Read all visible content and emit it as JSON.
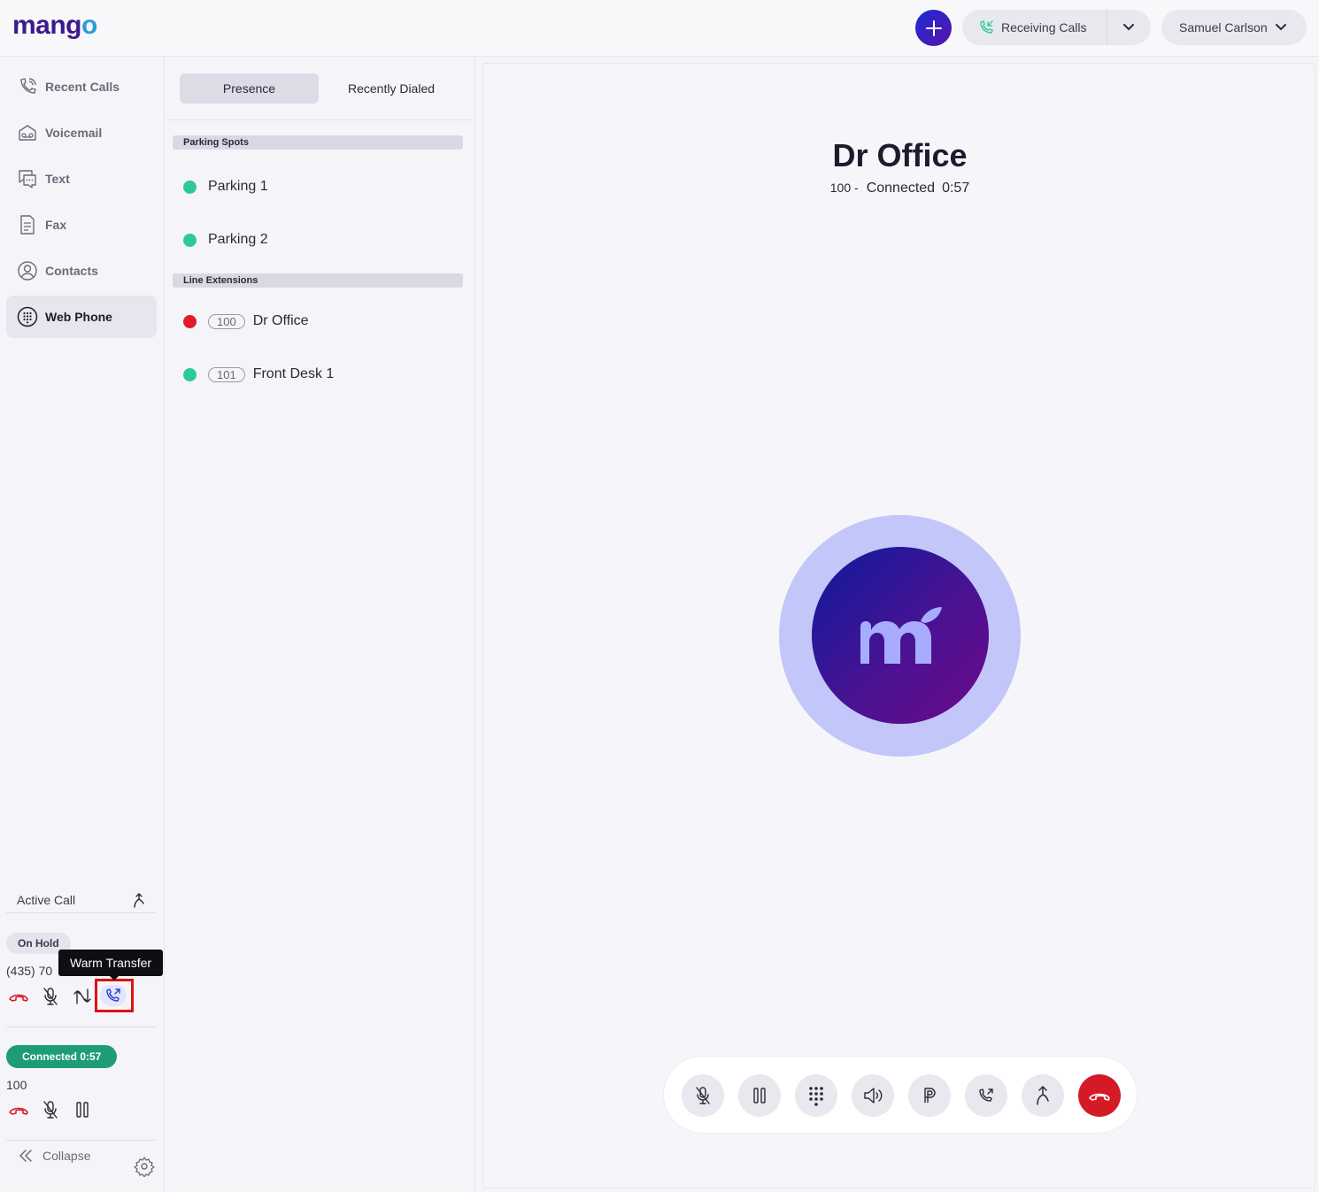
{
  "header": {
    "logo_main": "mang",
    "logo_o": "o",
    "receiving_calls_label": "Receiving Calls",
    "user_name": "Samuel Carlson"
  },
  "sidebar": {
    "items": [
      {
        "label": "Recent Calls",
        "icon": "recent-calls-icon"
      },
      {
        "label": "Voicemail",
        "icon": "voicemail-icon"
      },
      {
        "label": "Text",
        "icon": "text-icon"
      },
      {
        "label": "Fax",
        "icon": "fax-icon"
      },
      {
        "label": "Contacts",
        "icon": "contacts-icon"
      },
      {
        "label": "Web Phone",
        "icon": "web-phone-icon",
        "active": true
      }
    ],
    "active_call_label": "Active Call",
    "on_hold": {
      "badge": "On Hold",
      "number": "(435) 70",
      "tooltip": "Warm Transfer"
    },
    "connected": {
      "badge": "Connected 0:57",
      "number": "100"
    },
    "collapse_label": "Collapse"
  },
  "middle": {
    "tabs": [
      "Presence",
      "Recently Dialed"
    ],
    "parking_header": "Parking Spots",
    "parking": [
      {
        "name": "Parking 1",
        "status": "available"
      },
      {
        "name": "Parking 2",
        "status": "available"
      }
    ],
    "lines_header": "Line Extensions",
    "lines": [
      {
        "ext": "100",
        "name": "Dr Office",
        "status": "busy"
      },
      {
        "ext": "101",
        "name": "Front Desk 1",
        "status": "available"
      }
    ]
  },
  "call": {
    "name": "Dr Office",
    "ext": "100 -",
    "status": "Connected",
    "time": "0:57",
    "controls": [
      "mute-icon",
      "hold-icon",
      "keypad-icon",
      "speaker-icon",
      "park-icon",
      "warm-transfer-icon",
      "transfer-icon",
      "hangup-icon"
    ]
  },
  "colors": {
    "brand": "#3c1a8c",
    "available": "#2ec99a",
    "busy": "#e4192b",
    "connected_badge": "#1e9c78",
    "hangup": "#d41a27"
  }
}
